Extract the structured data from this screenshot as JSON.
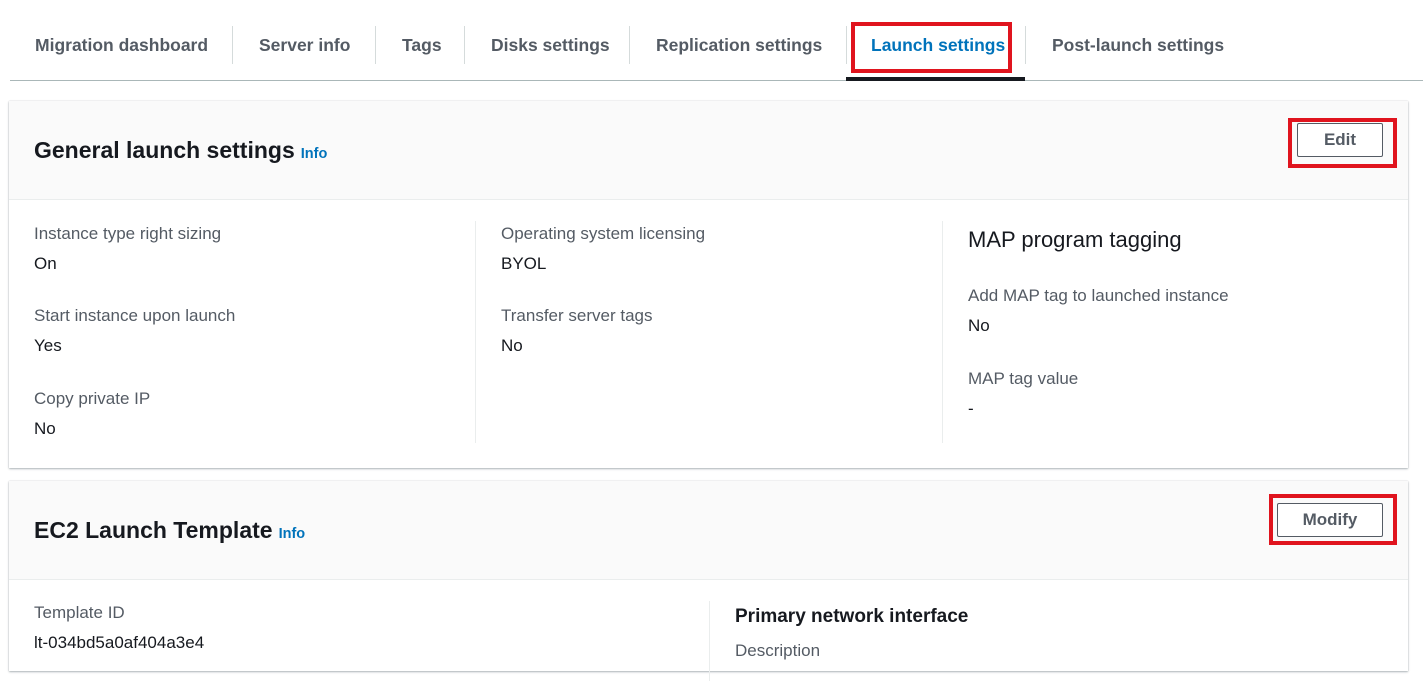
{
  "tabs": [
    {
      "label": "Migration dashboard"
    },
    {
      "label": "Server info"
    },
    {
      "label": "Tags"
    },
    {
      "label": "Disks settings"
    },
    {
      "label": "Replication settings"
    },
    {
      "label": "Launch settings"
    },
    {
      "label": "Post-launch settings"
    }
  ],
  "active_tab": "Launch settings",
  "general": {
    "title": "General launch settings",
    "info": "Info",
    "edit_label": "Edit",
    "col1": [
      {
        "label": "Instance type right sizing",
        "value": "On"
      },
      {
        "label": "Start instance upon launch",
        "value": "Yes"
      },
      {
        "label": "Copy private IP",
        "value": "No"
      }
    ],
    "col2": [
      {
        "label": "Operating system licensing",
        "value": "BYOL"
      },
      {
        "label": "Transfer server tags",
        "value": "No"
      }
    ],
    "map": {
      "title": "MAP program tagging",
      "items": [
        {
          "label": "Add MAP tag to launched instance",
          "value": "No"
        },
        {
          "label": "MAP tag value",
          "value": "-"
        }
      ]
    }
  },
  "ec2": {
    "title": "EC2 Launch Template",
    "info": "Info",
    "modify_label": "Modify",
    "template_id_label": "Template ID",
    "template_id_value": "lt-034bd5a0af404a3e4",
    "primary_network_title": "Primary network interface",
    "description_label": "Description"
  },
  "colors": {
    "accent": "#0073bb",
    "highlight": "#e0141e",
    "text": "#16191f",
    "muted": "#545b64"
  }
}
